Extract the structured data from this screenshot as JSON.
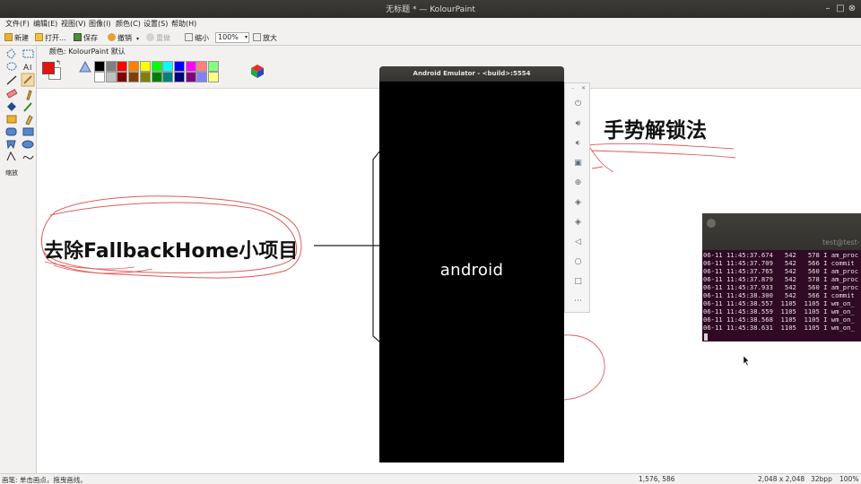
{
  "window": {
    "title": "无标题 * — KolourPaint"
  },
  "menu": [
    "文件(F)",
    "编辑(E)",
    "视图(V)",
    "图像(I)",
    "颜色(C)",
    "设置(S)",
    "帮助(H)"
  ],
  "toolbar": {
    "new": "新建",
    "open": "打开...",
    "save": "保存",
    "undo": "撤销",
    "redo": "重做",
    "zoom_out": "缩小",
    "zoom_value": "100%",
    "zoom_in": "放大"
  },
  "tools": {
    "zoom_label": "缩放"
  },
  "colors": {
    "label": "颜色: KolourPaint 默认",
    "foreground": "#e8120c",
    "background": "#ffffff",
    "palette_row1": [
      "#000000",
      "#808080",
      "#ff0000",
      "#ff8000",
      "#ffff00",
      "#00ff00",
      "#00ffff",
      "#0000ff",
      "#ff00ff",
      "#ff8080",
      "#80ff80"
    ],
    "palette_row2": [
      "#ffffff",
      "#c0c0c0",
      "#800000",
      "#804000",
      "#808000",
      "#008000",
      "#008080",
      "#000080",
      "#800080",
      "#8080ff",
      "#ffff80"
    ]
  },
  "canvas": {
    "left_text": "去除FallbackHome小项目",
    "right_text": "法，手势解锁法",
    "annotation_color": "#e05555"
  },
  "emulator": {
    "title": "Android Emulator - <build>:5554",
    "logo": "android",
    "panel_buttons": [
      "power-icon",
      "volume-up-icon",
      "volume-down-icon",
      "camera-icon",
      "zoom-icon",
      "rotate-left-icon",
      "rotate-right-icon",
      "back-icon",
      "home-icon",
      "overview-icon",
      "more-icon"
    ]
  },
  "terminal": {
    "title": "test@test-",
    "lines": [
      "06-11 11:45:37.674   542   578 I am_proc",
      "06-11 11:45:37.709   542   566 I commit",
      "06-11 11:45:37.765   542   560 I am_proc",
      "06-11 11:45:37.879   542   578 I am_proc",
      "06-11 11:45:37.933   542   560 I am_proc",
      "06-11 11:45:38.300   542   566 I commit",
      "06-11 11:45:38.557  1105  1105 I wm_on_",
      "06-11 11:45:38.559  1105  1105 I wm_on_",
      "06-11 11:45:38.568  1105  1105 I wm_on_",
      "06-11 11:45:38.631  1105  1105 I wm_on_"
    ]
  },
  "status": {
    "hint": "画笔: 单击画点，拖曳画线。",
    "cursor_pos": "1,576, 586",
    "image_size": "2,048 x 2,048",
    "depth": "32bpp",
    "zoom": "100%"
  }
}
